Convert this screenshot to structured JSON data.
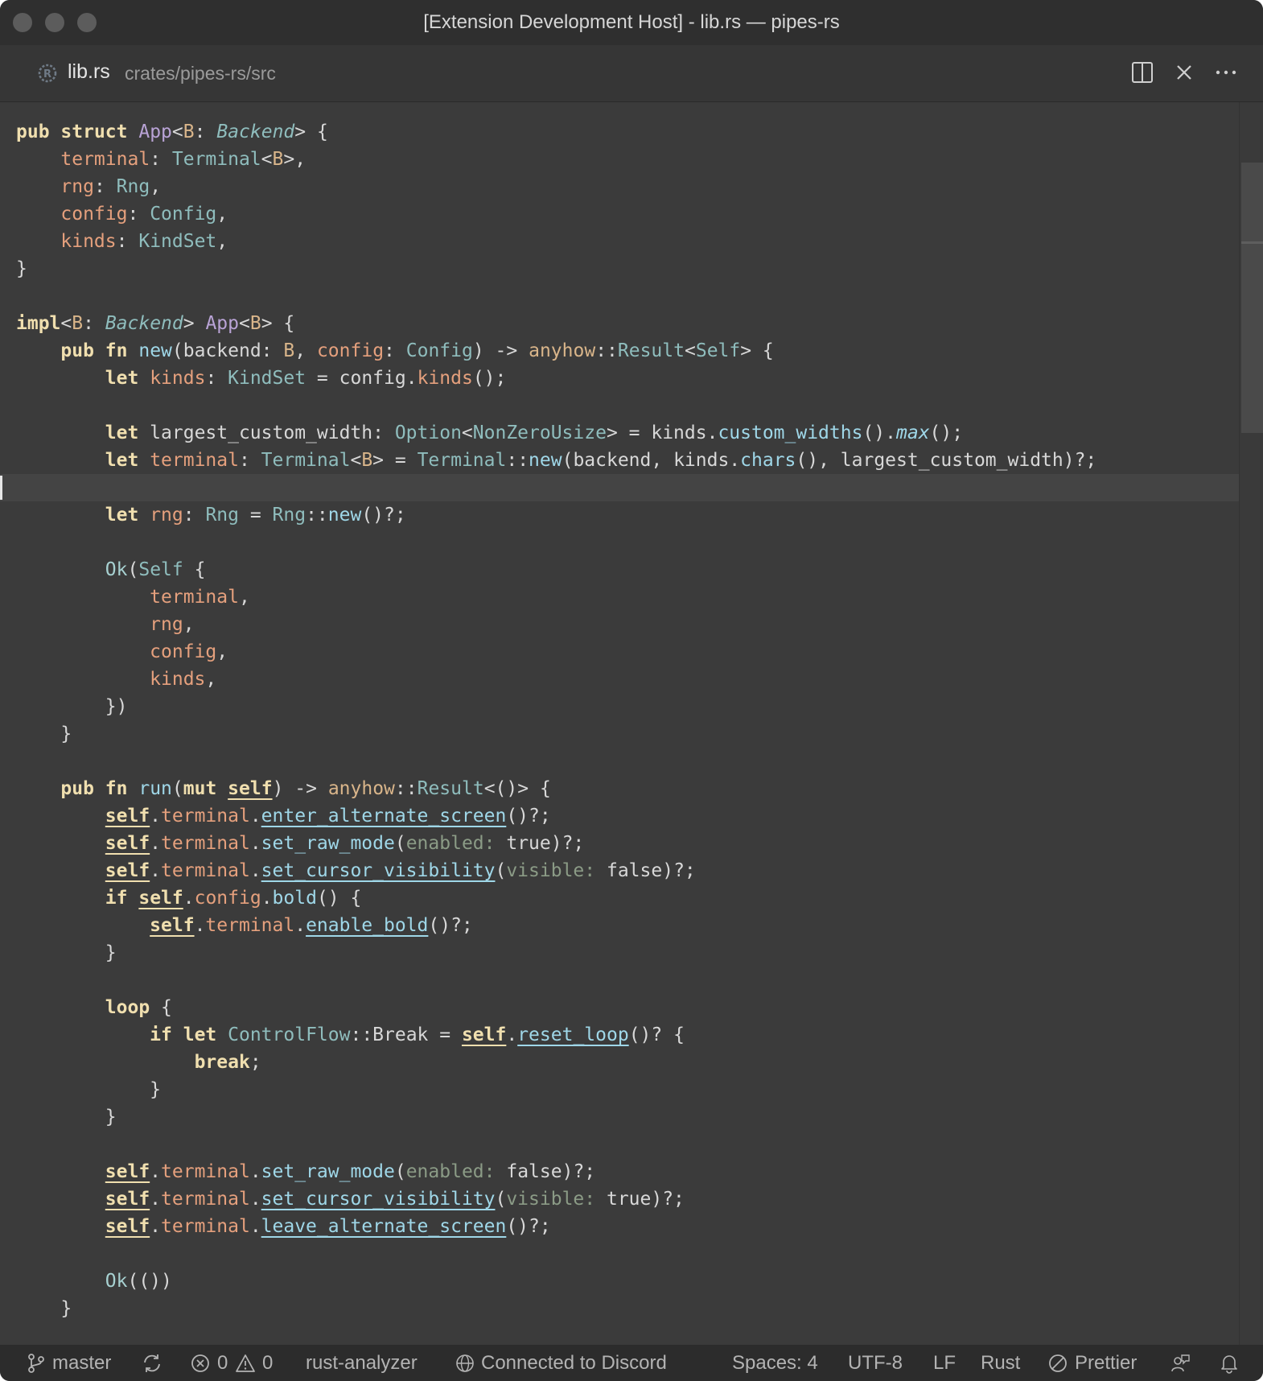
{
  "window": {
    "title": "[Extension Development Host] - lib.rs — pipes-rs"
  },
  "tab": {
    "name": "lib.rs",
    "path": "crates/pipes-rs/src"
  },
  "editor": {
    "language": "Rust",
    "cursor_line": 13,
    "code_lines": [
      "pub struct App<B: Backend> {",
      "    terminal: Terminal<B>,",
      "    rng: Rng,",
      "    config: Config,",
      "    kinds: KindSet,",
      "}",
      "",
      "impl<B: Backend> App<B> {",
      "    pub fn new(backend: B, config: Config) -> anyhow::Result<Self> {",
      "        let kinds: KindSet = config.kinds();",
      "",
      "        let largest_custom_width: Option<NonZeroUsize> = kinds.custom_widths().max();",
      "        let terminal: Terminal<B> = Terminal::new(backend, kinds.chars(), largest_custom_width)?;",
      "",
      "        let rng: Rng = Rng::new()?;",
      "",
      "        Ok(Self {",
      "            terminal,",
      "            rng,",
      "            config,",
      "            kinds,",
      "        })",
      "    }",
      "",
      "    pub fn run(mut self) -> anyhow::Result<()> {",
      "        self.terminal.enter_alternate_screen()?;",
      "        self.terminal.set_raw_mode(enabled: true)?;",
      "        self.terminal.set_cursor_visibility(visible: false)?;",
      "        if self.config.bold() {",
      "            self.terminal.enable_bold()?;",
      "        }",
      "",
      "        loop {",
      "            if let ControlFlow::Break = self.reset_loop()? {",
      "                break;",
      "            }",
      "        }",
      "",
      "        self.terminal.set_raw_mode(enabled: false)?;",
      "        self.terminal.set_cursor_visibility(visible: true)?;",
      "        self.terminal.leave_alternate_screen()?;",
      "",
      "        Ok(())",
      "    }"
    ]
  },
  "statusbar": {
    "branch": "master",
    "errors": "0",
    "warnings": "0",
    "language_server": "rust-analyzer",
    "discord": "Connected to Discord",
    "indent": "Spaces: 4",
    "encoding": "UTF-8",
    "eol": "LF",
    "language_mode": "Rust",
    "formatter": "Prettier"
  },
  "icons": {
    "tab": "rust-file-icon",
    "split": "split-editor-icon",
    "close": "close-icon",
    "more": "more-actions-icon",
    "branch": "git-branch-icon",
    "sync": "sync-icon",
    "error": "error-icon",
    "warning": "warning-icon",
    "globe": "globe-icon",
    "prettier": "prettier-disabled-icon",
    "feedback": "feedback-icon",
    "bell": "bell-icon"
  }
}
